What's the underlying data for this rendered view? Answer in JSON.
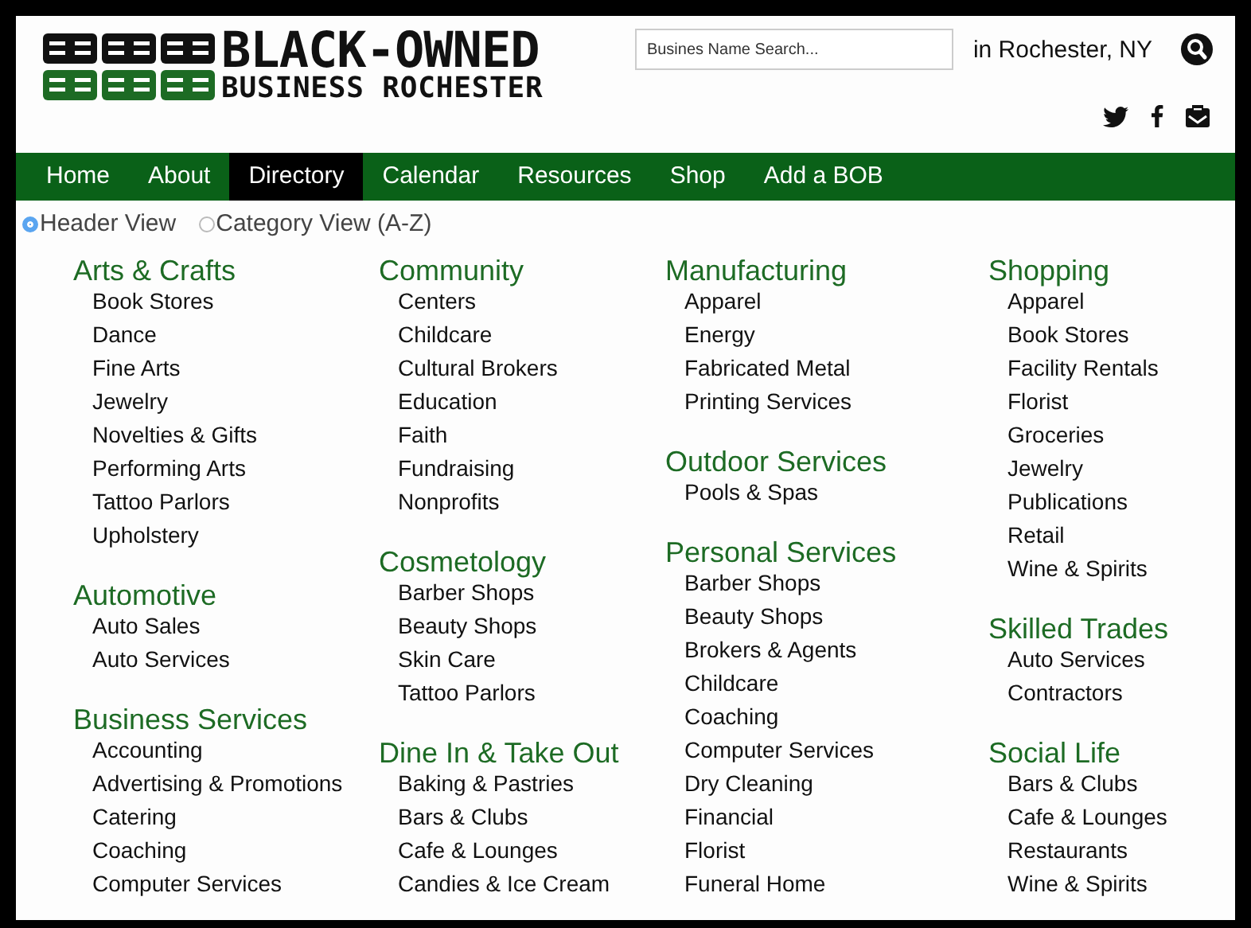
{
  "logo": {
    "line1": "BLACK-OWNED",
    "line2": "BUSINESS ROCHESTER"
  },
  "search": {
    "placeholder": "Busines Name Search...",
    "location": "in  Rochester, NY"
  },
  "nav": [
    {
      "label": "Home",
      "selected": false
    },
    {
      "label": "About",
      "selected": false
    },
    {
      "label": "Directory",
      "selected": true
    },
    {
      "label": "Calendar",
      "selected": false
    },
    {
      "label": "Resources",
      "selected": false
    },
    {
      "label": "Shop",
      "selected": false
    },
    {
      "label": "Add a BOB",
      "selected": false
    }
  ],
  "view_options": [
    {
      "label": "Header View",
      "selected": true
    },
    {
      "label": "Category View (A-Z)",
      "selected": false
    }
  ],
  "columns": [
    [
      {
        "heading": "Arts & Crafts",
        "items": [
          "Book Stores",
          "Dance",
          "Fine Arts",
          "Jewelry",
          "Novelties & Gifts",
          "Performing Arts",
          "Tattoo Parlors",
          "Upholstery"
        ]
      },
      {
        "heading": "Automotive",
        "items": [
          "Auto Sales",
          "Auto Services"
        ]
      },
      {
        "heading": "Business Services",
        "items": [
          "Accounting",
          "Advertising & Promotions",
          "Catering",
          "Coaching",
          "Computer Services"
        ]
      }
    ],
    [
      {
        "heading": "Community",
        "items": [
          "Centers",
          "Childcare",
          "Cultural Brokers",
          "Education",
          "Faith",
          "Fundraising",
          "Nonprofits"
        ]
      },
      {
        "heading": "Cosmetology",
        "items": [
          "Barber Shops",
          "Beauty Shops",
          "Skin Care",
          "Tattoo Parlors"
        ]
      },
      {
        "heading": "Dine In & Take Out",
        "items": [
          "Baking & Pastries",
          "Bars & Clubs",
          "Cafe & Lounges",
          "Candies & Ice Cream"
        ]
      }
    ],
    [
      {
        "heading": "Manufacturing",
        "items": [
          "Apparel",
          "Energy",
          "Fabricated Metal",
          "Printing Services"
        ]
      },
      {
        "heading": "Outdoor Services",
        "items": [
          "Pools & Spas"
        ]
      },
      {
        "heading": "Personal Services",
        "items": [
          "Barber Shops",
          "Beauty Shops",
          "Brokers & Agents",
          "Childcare",
          "Coaching",
          "Computer Services",
          "Dry Cleaning",
          "Financial",
          "Florist",
          "Funeral Home"
        ]
      }
    ],
    [
      {
        "heading": "Shopping",
        "items": [
          "Apparel",
          "Book Stores",
          "Facility Rentals",
          "Florist",
          "Groceries",
          "Jewelry",
          "Publications",
          "Retail",
          "Wine & Spirits"
        ]
      },
      {
        "heading": "Skilled Trades",
        "items": [
          "Auto Services",
          "Contractors"
        ]
      },
      {
        "heading": "Social Life",
        "items": [
          "Bars & Clubs",
          "Cafe & Lounges",
          "Restaurants",
          "Wine & Spirits"
        ]
      }
    ]
  ]
}
